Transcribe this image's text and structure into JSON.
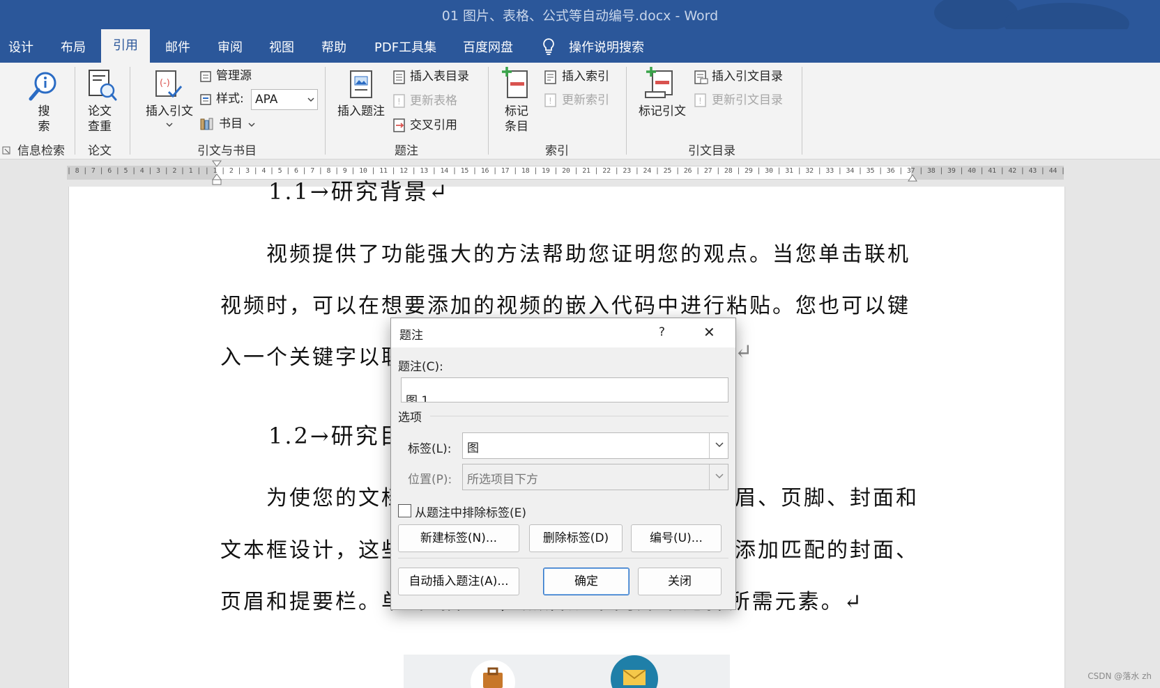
{
  "window": {
    "title": "01 图片、表格、公式等自动编号.docx  -  Word"
  },
  "tabs": [
    "设计",
    "布局",
    "引用",
    "邮件",
    "审阅",
    "视图",
    "帮助",
    "PDF工具集",
    "百度网盘"
  ],
  "active_tab": "引用",
  "tell_me": "操作说明搜索",
  "ribbon": {
    "groups": [
      "信息检索",
      "论文",
      "引文与书目",
      "题注",
      "索引",
      "引文目录"
    ],
    "search": {
      "line1": "搜",
      "line2": "索"
    },
    "paper_check": {
      "line1": "论文",
      "line2": "查重"
    },
    "insert_citation": "插入引文",
    "manage_sources": "管理源",
    "style_label": "样式:",
    "style_value": "APA",
    "bibliography": "书目",
    "insert_caption": "插入题注",
    "insert_table_of_figures": "插入表目录",
    "update_table": "更新表格",
    "cross_reference": "交叉引用",
    "mark_entry": {
      "line1": "标记",
      "line2": "条目"
    },
    "insert_index": "插入索引",
    "update_index": "更新索引",
    "mark_citation": "标记引文",
    "insert_table_of_authorities": "插入引文目录",
    "update_table_of_authorities": "更新引文目录"
  },
  "ruler": {
    "text": "| 8 | 7 | 6 | 5 | 4 | 3 | 2 | 1 |    | 1 | 2 | 3 | 4 | 5 | 6 | 7 | 8 | 9 | 10 | 11 | 12 | 13 | 14 | 15 | 16 | 17 | 18 | 19 | 20 | 21 | 22 | 23 | 24 | 25 | 26 | 27 | 28 | 29 | 30 | 31 | 32 | 33 | 34 | 35 | 36 | 37 | 38 | 39 | 40 | 41 | 42 | 43 | 44 | 45 | 46 | 47 | 48"
  },
  "document": {
    "heading1": "1.1→研究背景↵",
    "para1_line1": "视频提供了功能强大的方法帮助您证明您的观点。当您单击联机",
    "para1_line2": "视频时，可以在想要添加的视频的嵌入代码中进行粘贴。您也可以键",
    "para1_line3": "入一个关键字以联",
    "para1_end": "↵",
    "heading2": "1.2→研究目",
    "para2_line1_left": "为使您的文档",
    "para2_line1_right": "眉、页脚、封面和",
    "para2_line2_left": "文本框设计，这些",
    "para2_line2_right": "添加匹配的封面、",
    "para2_line3": "页眉和提要栏。单击“插入”，然后从不同库中选择所需元素。↵"
  },
  "dialog": {
    "title": "题注",
    "help": "?",
    "close_x": "✕",
    "caption_label": "题注(C):",
    "caption_value": "图 1",
    "options_label": "选项",
    "label_label": "标签(L):",
    "label_value": "图",
    "position_label": "位置(P):",
    "position_value": "所选项目下方",
    "exclude_label": "从题注中排除标签(E)",
    "exclude_checked": false,
    "new_label_btn": "新建标签(N)...",
    "delete_label_btn": "删除标签(D)",
    "numbering_btn": "编号(U)...",
    "autocaption_btn": "自动插入题注(A)...",
    "ok_btn": "确定",
    "close_btn": "关闭"
  },
  "watermark": "CSDN @落水 zh",
  "colors": {
    "titlebar": "#2b579a",
    "ribbon": "#f3f3f3",
    "accent_red": "#d9534f",
    "accent_green": "#3aa34a"
  }
}
